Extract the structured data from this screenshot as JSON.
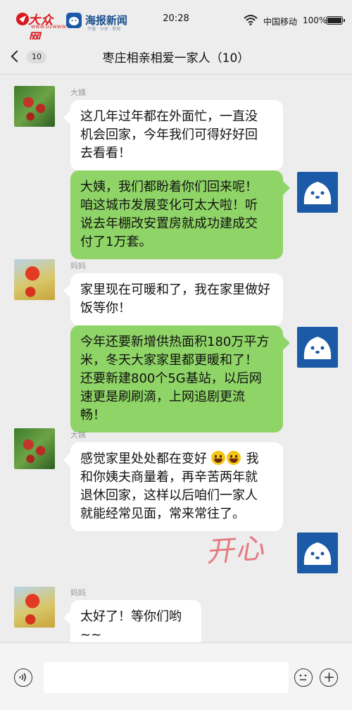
{
  "status_bar": {
    "logo_left_text": "大众网",
    "logo_left_sub": "WWW.DZWWW.COM",
    "logo_right_text": "海报新闻",
    "logo_right_sub": "传播 · 分享 · 新闻",
    "time": "20:28",
    "carrier": "中国移动",
    "battery": "100%"
  },
  "nav": {
    "back_count": "10",
    "title": "枣庄相亲相爱一家人（10）"
  },
  "messages": [
    {
      "side": "left",
      "sender": "大姨",
      "avatar": "apple-tree-avatar",
      "lines": [
        "这几年过年都在外面忙，一直没",
        "机会回家，今年我们可得好好回",
        "去看看！"
      ]
    },
    {
      "side": "right",
      "sender": "",
      "avatar": "seal-avatar",
      "lines": [
        "大姨，我们都盼着你们回来呢！",
        "咱这城市发展变化可太大啦！听",
        "说去年棚改安置房就成功建成交",
        "付了1万套。"
      ]
    },
    {
      "side": "left",
      "sender": "妈妈",
      "avatar": "pomegranate-avatar",
      "lines": [
        "家里现在可暖和了，我在家里做好",
        "饭等你！"
      ]
    },
    {
      "side": "right",
      "sender": "",
      "avatar": "seal-avatar",
      "lines": [
        "今年还要新增供热面积180万平方",
        "米，冬天大家家里都更暖和了！",
        "还要新建800个5G基站，以后网",
        "速更是刷刷滴，上网追剧更流",
        "畅！"
      ]
    },
    {
      "side": "left",
      "sender": "大姨",
      "avatar": "apple-tree-avatar",
      "line1_before_emoji": "感觉家里处处都在变好 ",
      "line1_after_emoji": " 我",
      "lines": [
        "和你姨夫商量着，再辛苦两年就",
        "退休回家，这样以后咱们一家人",
        "就能经常见面，常来常往了。"
      ]
    },
    {
      "side": "right",
      "sender": "",
      "avatar": "seal-avatar",
      "sticker_text": "开心"
    },
    {
      "side": "left",
      "sender": "妈妈",
      "avatar": "pomegranate-avatar",
      "lines": [
        "太好了！等你们哟~~"
      ]
    }
  ],
  "input_bar": {
    "placeholder": ""
  },
  "colors": {
    "bubble_green": "#8fd466",
    "bubble_white": "#ffffff",
    "background": "#ededed",
    "seal_blue": "#1b5aa6"
  }
}
